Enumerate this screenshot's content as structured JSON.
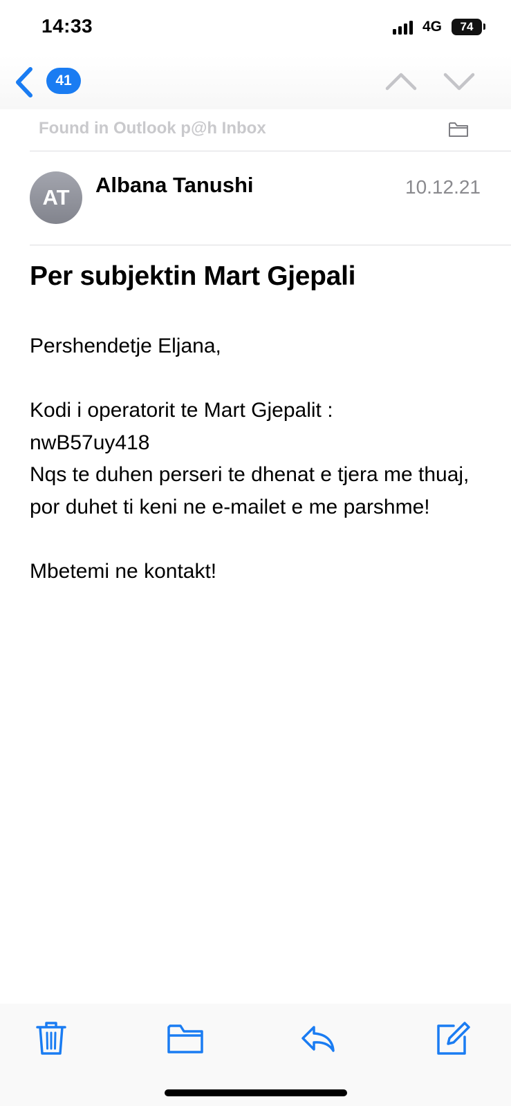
{
  "status_bar": {
    "time": "14:33",
    "network": "4G",
    "battery": "74"
  },
  "nav": {
    "unread_count": "41",
    "icons": [
      "chevron-left-icon",
      "chevron-up-icon",
      "chevron-down-icon"
    ]
  },
  "location": {
    "text": "Found in Outlook p@h Inbox",
    "icon": "folder-icon"
  },
  "message": {
    "avatar_initials": "AT",
    "sender": "Albana Tanushi",
    "date": "10.12.21",
    "subject": "Per subjektin Mart Gjepali",
    "body": {
      "greeting": "Pershendetje Eljana,",
      "line1": "Kodi i operatorit te Mart Gjepalit :",
      "code": "nwB57uy418",
      "line2": "Nqs te duhen perseri te dhenat e tjera me thuaj, por duhet ti keni ne e-mailet e me parshme!",
      "closing": "Mbetemi ne kontakt!"
    }
  },
  "toolbar": {
    "icons": [
      "trash-icon",
      "folder-icon",
      "reply-icon",
      "compose-icon"
    ]
  },
  "colors": {
    "accent": "#1a7cf2",
    "muted_text": "#8a8a8e",
    "location_text": "#c9c9cc",
    "avatar_bg": "#8f919a"
  }
}
